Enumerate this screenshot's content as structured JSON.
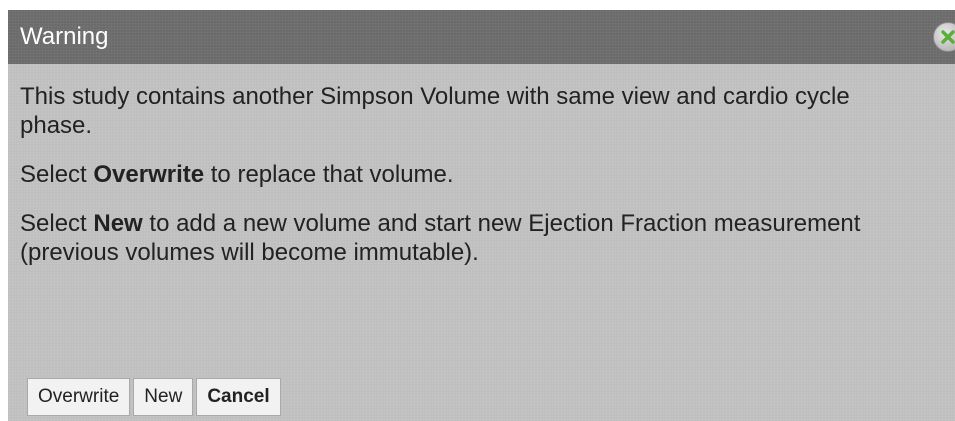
{
  "dialog": {
    "title": "Warning",
    "close_icon": "close-icon",
    "message": {
      "line1": "This study contains another Simpson Volume with same view and cardio cycle phase.",
      "line2_prefix": "Select ",
      "line2_bold": "Overwrite",
      "line2_suffix": " to replace that volume.",
      "line3_prefix": "Select ",
      "line3_bold": "New",
      "line3_suffix": " to add a new volume and start new Ejection Fraction measurement (previous volumes will become immutable)."
    },
    "buttons": {
      "overwrite": "Overwrite",
      "new": "New",
      "cancel": "Cancel"
    }
  },
  "colors": {
    "title_bar": "#6b6b6b",
    "body": "#bfbfbf",
    "close_x": "#5cae3c"
  }
}
